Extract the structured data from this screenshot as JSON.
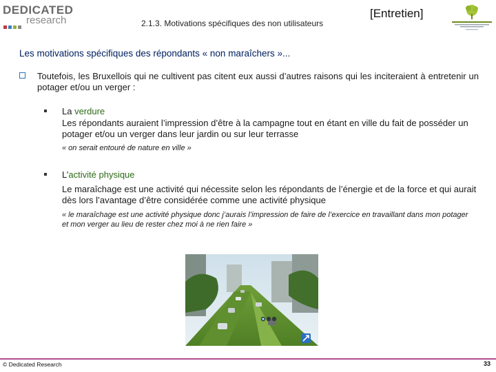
{
  "header": {
    "logo_top": "DEDICATED",
    "logo_bottom": "research",
    "section_code": "2.1.3. Motivations spécifiques des non utilisateurs",
    "interview_tag": "[Entretien]",
    "brand_colors": [
      "#c0393b",
      "#3f7dbf",
      "#8db23c",
      "#6a6a6a"
    ]
  },
  "content": {
    "heading": "Les motivations spécifiques des répondants « non maraîchers »...",
    "intro": "Toutefois, les Bruxellois qui ne cultivent pas citent eux aussi d’autres raisons qui les inciteraient à entretenir un potager et/ou un verger :",
    "items": [
      {
        "title_prefix": "La ",
        "title_highlight": "verdure",
        "body": "Les répondants auraient l’impression d’être à la campagne tout en étant en ville du fait de posséder un potager et/ou un verger dans leur jardin ou sur leur terrasse",
        "quote": "« on serait entouré de nature en ville »"
      },
      {
        "title_prefix": "L’",
        "title_highlight": "activité physique",
        "body": "Le maraîchage est une activité qui nécessite selon les répondants de l’énergie et de la force et qui aurait dès lors l’avantage d’être considérée comme une activité physique",
        "quote": "« le maraîchage est une activité physique donc j’aurais l’impression de faire de l’exercice en travaillant dans mon potager et mon verger au lieu de rester chez moi à ne rien faire »"
      }
    ]
  },
  "footer": {
    "copyright": "© Dedicated Research",
    "page_number": "33"
  }
}
